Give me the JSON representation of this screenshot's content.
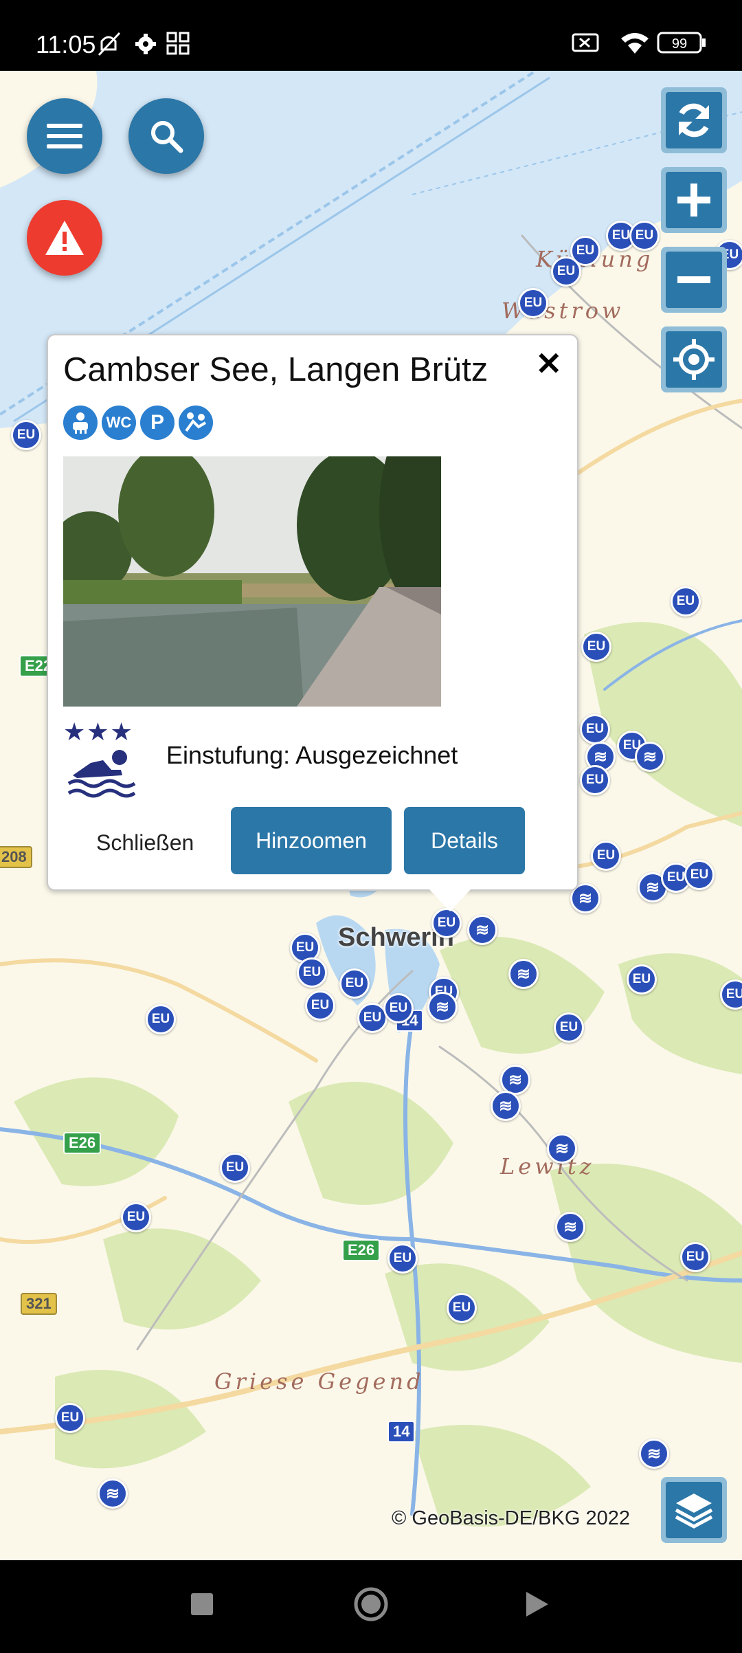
{
  "status_bar": {
    "time": "11:05",
    "battery": "99"
  },
  "popup": {
    "title": "Cambser See, Langen Brütz",
    "close_symbol": "✕",
    "facility_icons": [
      "shower-icon",
      "wc-icon",
      "parking-icon",
      "playground-icon"
    ],
    "facility_labels": {
      "wc": "WC",
      "parking": "P"
    },
    "stars": "★★★",
    "rating_text": "Einstufung: Ausgezeichnet",
    "buttons": {
      "close": "Schließen",
      "zoom": "Hinzoomen",
      "details": "Details"
    }
  },
  "map": {
    "labels": {
      "kuhlung": "Kühlung",
      "wustrow": "Wustrow",
      "schwerin": "Schwerin",
      "lewitz": "Lewitz",
      "griese_gegend": "Griese Gegend"
    },
    "road_shields": {
      "e22": "E22",
      "e26_a": "E26",
      "e26_b": "E26",
      "r208": "208",
      "r321": "321",
      "a14_a": "14",
      "a14_b": "14"
    },
    "marker_label": "EU",
    "copyright": "© GeoBasis-DE/BKG 2022"
  },
  "colors": {
    "primary": "#2b77a8",
    "alert": "#ee3b2f",
    "marker": "#2a4fb8",
    "water": "#d3e7f7"
  }
}
